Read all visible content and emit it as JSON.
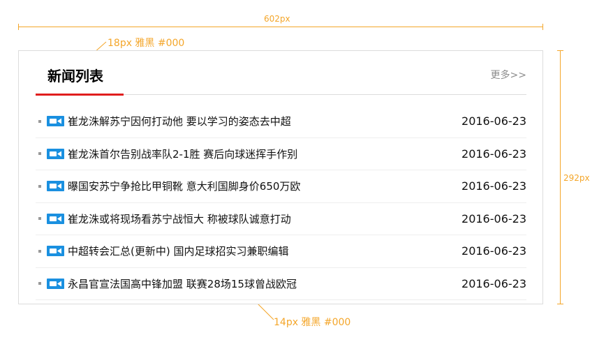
{
  "annotations": {
    "width_label": "602px",
    "height_label": "292px",
    "header_height_label": "50px",
    "title_style_label": "18px 雅黑 #000",
    "item_style_label": "14px 雅黑 #000",
    "accent_color": "#f4a62a"
  },
  "panel": {
    "title": "新闻列表",
    "more_label": "更多>>",
    "underline_color": "#e01e1e",
    "items": [
      {
        "icon": "video-camera-icon",
        "title": "崔龙洙解苏宁因何打动他 要以学习的姿态去中超",
        "date": "2016-06-23"
      },
      {
        "icon": "video-camera-icon",
        "title": "崔龙洙首尔告别战率队2-1胜 赛后向球迷挥手作别",
        "date": "2016-06-23"
      },
      {
        "icon": "video-camera-icon",
        "title": "曝国安苏宁争抢比甲铜靴 意大利国脚身价650万欧",
        "date": "2016-06-23"
      },
      {
        "icon": "video-camera-icon",
        "title": "崔龙洙或将现场看苏宁战恒大 称被球队诚意打动",
        "date": "2016-06-23"
      },
      {
        "icon": "video-camera-icon",
        "title": "中超转会汇总(更新中) 国内足球招实习兼职编辑",
        "date": "2016-06-23"
      },
      {
        "icon": "video-camera-icon",
        "title": "永昌官宣法国高中锋加盟 联赛28场15球曾战欧冠",
        "date": "2016-06-23"
      }
    ],
    "icon_color": "#1a90e0"
  }
}
